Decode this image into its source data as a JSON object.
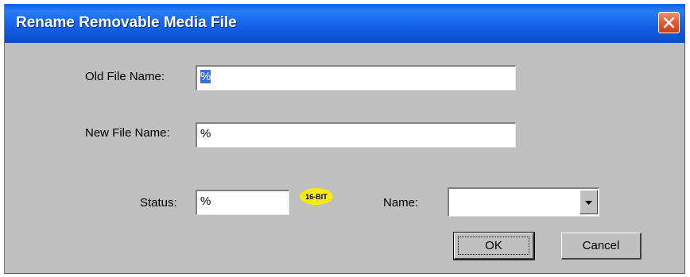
{
  "window": {
    "title": "Rename Removable Media File"
  },
  "form": {
    "old_file_name": {
      "label": "Old File Name:",
      "value": "%"
    },
    "new_file_name": {
      "label": "New File Name:",
      "value": "%"
    },
    "status": {
      "label": "Status:",
      "value": "%"
    },
    "badge": {
      "text": "16-BIT",
      "color": "#f5ec0a"
    },
    "name": {
      "label": "Name:",
      "selected_value": ""
    }
  },
  "buttons": {
    "ok_label": "OK",
    "cancel_label": "Cancel"
  },
  "icons": {
    "close": "close-icon",
    "dropdown": "chevron-down-icon"
  },
  "colors": {
    "titlebar": "#1665ea",
    "dialog_bg": "#c0c0c0",
    "close_button": "#e35a30",
    "selection": "#3a6fd8"
  }
}
